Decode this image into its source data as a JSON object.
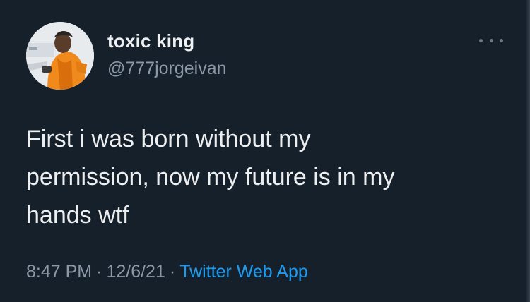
{
  "tweet": {
    "author": {
      "display_name": "toxic king",
      "handle": "@777jorgeivan",
      "avatar_icon": "profile-photo"
    },
    "more_icon": "more-options-icon",
    "text": "First i was born without my\npermission, now my future is in my\nhands wtf",
    "time": "8:47 PM",
    "date": "12/6/21",
    "separator": "·",
    "source": "Twitter Web App"
  },
  "colors": {
    "background": "#16202b",
    "primary_text": "#e7e9ea",
    "secondary_text": "#8b98a5",
    "accent": "#1d9bf0"
  }
}
